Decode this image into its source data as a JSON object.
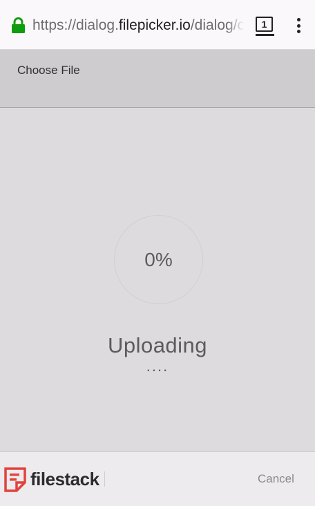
{
  "browser": {
    "url_prefix": "https://dialog.",
    "url_host": "filepicker.io",
    "url_suffix": "/dialog/c",
    "tab_count": "1",
    "lock_icon": "lock-icon",
    "menu_icon": "more-vert-icon"
  },
  "dialog": {
    "title": "Choose File"
  },
  "upload": {
    "progress_label": "0%",
    "progress": 0,
    "status": "Uploading",
    "dots": "...."
  },
  "footer": {
    "brand": "filestack",
    "cancel_label": "Cancel"
  },
  "colors": {
    "lock": "#0f9d0f",
    "brand_logo": "#e0433b",
    "background": "#dedbdf",
    "header_bg": "#cfccd0"
  }
}
